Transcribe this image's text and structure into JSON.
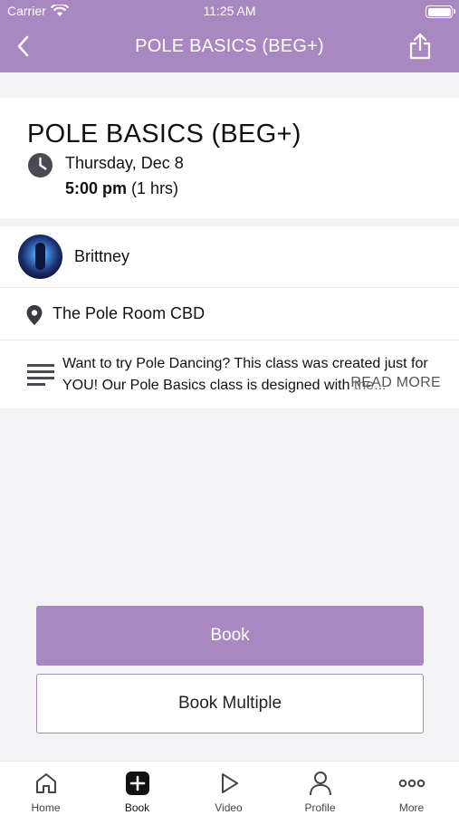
{
  "status_bar": {
    "carrier": "Carrier",
    "time": "11:25 AM"
  },
  "nav": {
    "title": "POLE BASICS (BEG+)"
  },
  "class": {
    "name": "POLE BASICS (BEG+)",
    "date": "Thursday, Dec 8",
    "time": "5:00 pm",
    "duration": "(1 hrs)"
  },
  "instructor": {
    "name": "Brittney"
  },
  "location": {
    "name": "The Pole Room CBD"
  },
  "description": {
    "text": "Want to try Pole Dancing? This class was created just for YOU! Our Pole Basics class is designed with the...",
    "read_more": "READ MORE"
  },
  "actions": {
    "book": "Book",
    "book_multiple": "Book Multiple"
  },
  "tabs": [
    {
      "label": "Home",
      "icon": "home-icon"
    },
    {
      "label": "Book",
      "icon": "plus-square-icon"
    },
    {
      "label": "Video",
      "icon": "play-icon"
    },
    {
      "label": "Profile",
      "icon": "user-icon"
    },
    {
      "label": "More",
      "icon": "more-dots-icon"
    }
  ],
  "theme": {
    "accent": "#a987c0"
  }
}
